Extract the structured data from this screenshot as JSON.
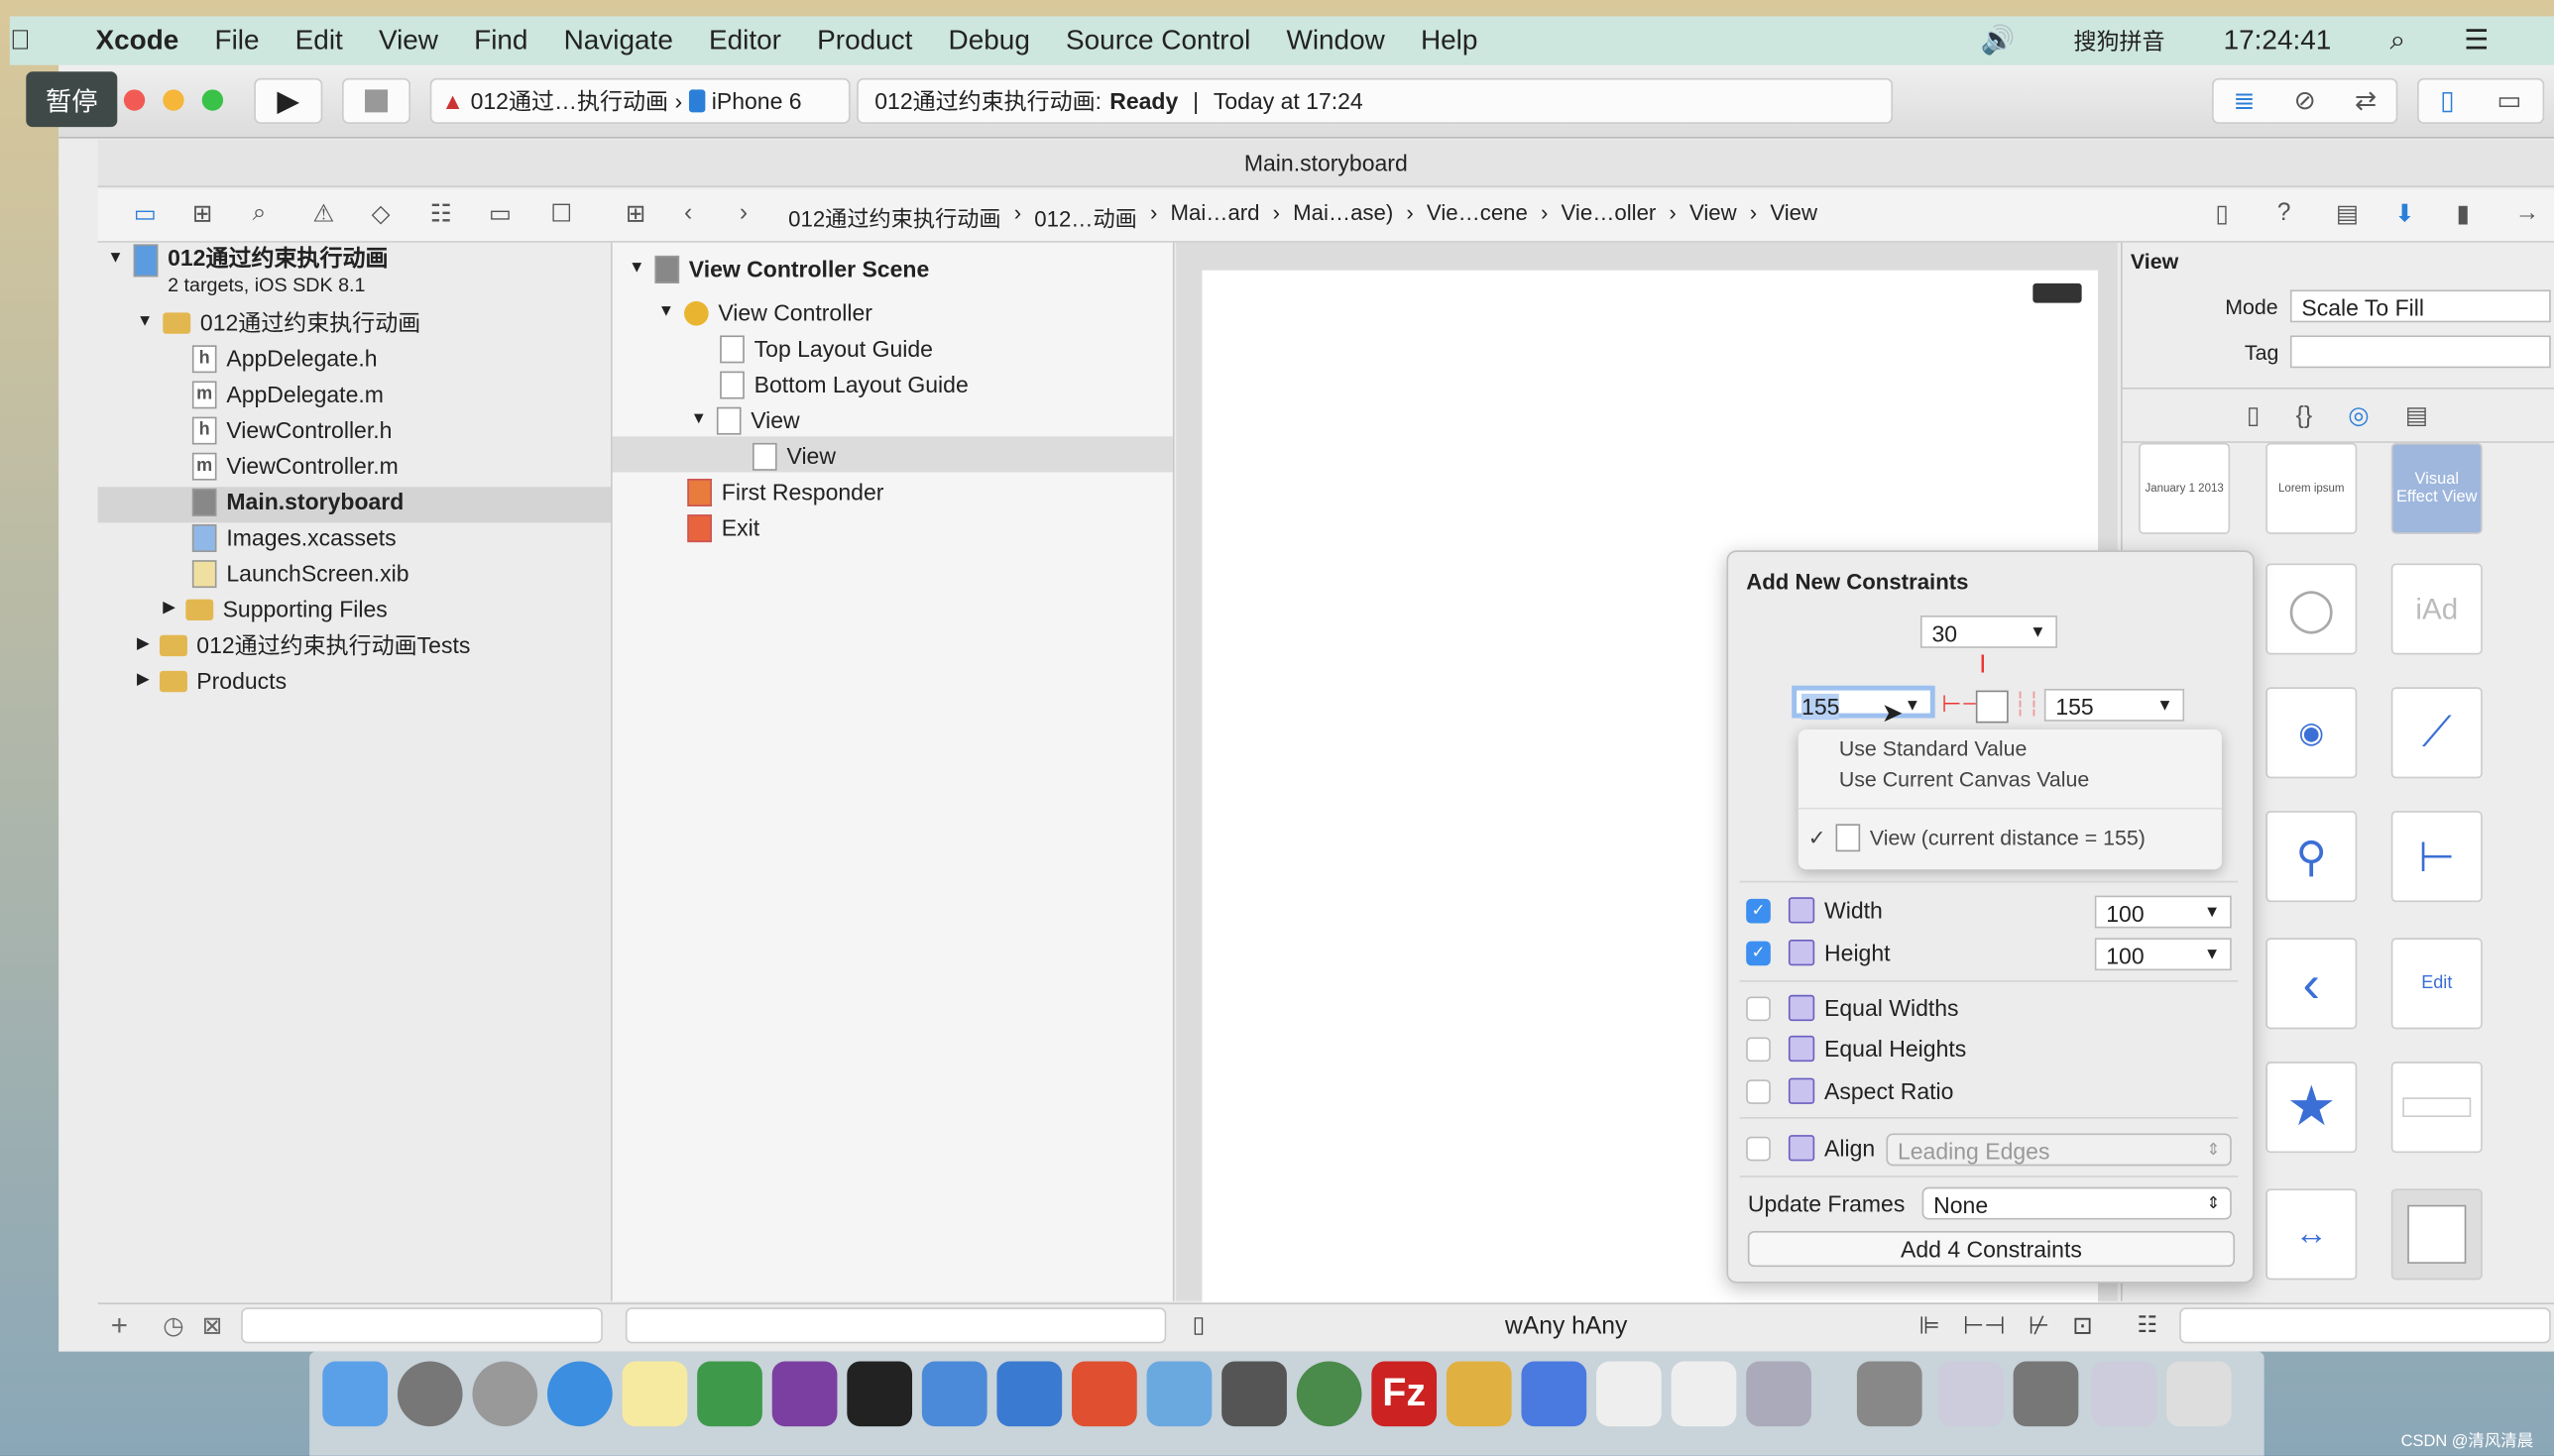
{
  "menubar": {
    "app": "Xcode",
    "items": [
      "File",
      "Edit",
      "View",
      "Find",
      "Navigate",
      "Editor",
      "Product",
      "Debug",
      "Source Control",
      "Window",
      "Help"
    ],
    "input_method": "搜狗拼音",
    "clock": "17:24:41"
  },
  "overlay": {
    "pause_label": "暂停"
  },
  "toolbar": {
    "scheme": "012通过…执行动画",
    "device": "iPhone 6",
    "status_project": "012通过约束执行动画:",
    "status_state": "Ready",
    "status_time": "Today at 17:24"
  },
  "window": {
    "title": "Main.storyboard"
  },
  "jumpbar": [
    "012通过约束执行动画",
    "012…动画",
    "Mai…ard",
    "Mai…ase)",
    "Vie…cene",
    "Vie…oller",
    "View",
    "View"
  ],
  "navigator": {
    "project": {
      "name": "012通过约束执行动画",
      "subtitle": "2 targets, iOS SDK 8.1"
    },
    "items": [
      {
        "label": "012通过约束执行动画",
        "type": "folder"
      },
      {
        "label": "AppDelegate.h",
        "type": "h"
      },
      {
        "label": "AppDelegate.m",
        "type": "m"
      },
      {
        "label": "ViewController.h",
        "type": "h"
      },
      {
        "label": "ViewController.m",
        "type": "m"
      },
      {
        "label": "Main.storyboard",
        "type": "sb"
      },
      {
        "label": "Images.xcassets",
        "type": "assets"
      },
      {
        "label": "LaunchScreen.xib",
        "type": "xib"
      },
      {
        "label": "Supporting Files",
        "type": "folder"
      },
      {
        "label": "012通过约束执行动画Tests",
        "type": "folder"
      },
      {
        "label": "Products",
        "type": "folder"
      }
    ]
  },
  "outline": {
    "scene": "View Controller Scene",
    "items": [
      "View Controller",
      "Top Layout Guide",
      "Bottom Layout Guide",
      "View",
      "View",
      "First Responder",
      "Exit"
    ]
  },
  "inspector": {
    "section": "View",
    "mode_label": "Mode",
    "mode_value": "Scale To Fill",
    "tag_label": "Tag",
    "tag_value": "",
    "library_labels": {
      "date": "January 1 2013",
      "lorem": "Lorem ipsum",
      "visual_effect": "Visual Effect View",
      "iad": "iAd",
      "edit": "Edit"
    }
  },
  "canvas": {
    "size_class": "wAny hAny"
  },
  "popover": {
    "title": "Add New Constraints",
    "top": "30",
    "leading": "155",
    "trailing": "155",
    "menu": {
      "items": [
        "Use Standard Value",
        "Use Current Canvas Value"
      ],
      "checked_item": "View (current distance = 155)"
    },
    "width": {
      "label": "Width",
      "checked": true,
      "value": "100"
    },
    "height": {
      "label": "Height",
      "checked": true,
      "value": "100"
    },
    "equal_widths": {
      "label": "Equal Widths",
      "checked": false
    },
    "equal_heights": {
      "label": "Equal Heights",
      "checked": false
    },
    "aspect_ratio": {
      "label": "Aspect Ratio",
      "checked": false
    },
    "align": {
      "label": "Align",
      "checked": false,
      "value": "Leading Edges"
    },
    "update_frames": {
      "label": "Update Frames",
      "value": "None"
    },
    "add_button": "Add 4 Constraints"
  },
  "watermark": "CSDN @清风清晨"
}
